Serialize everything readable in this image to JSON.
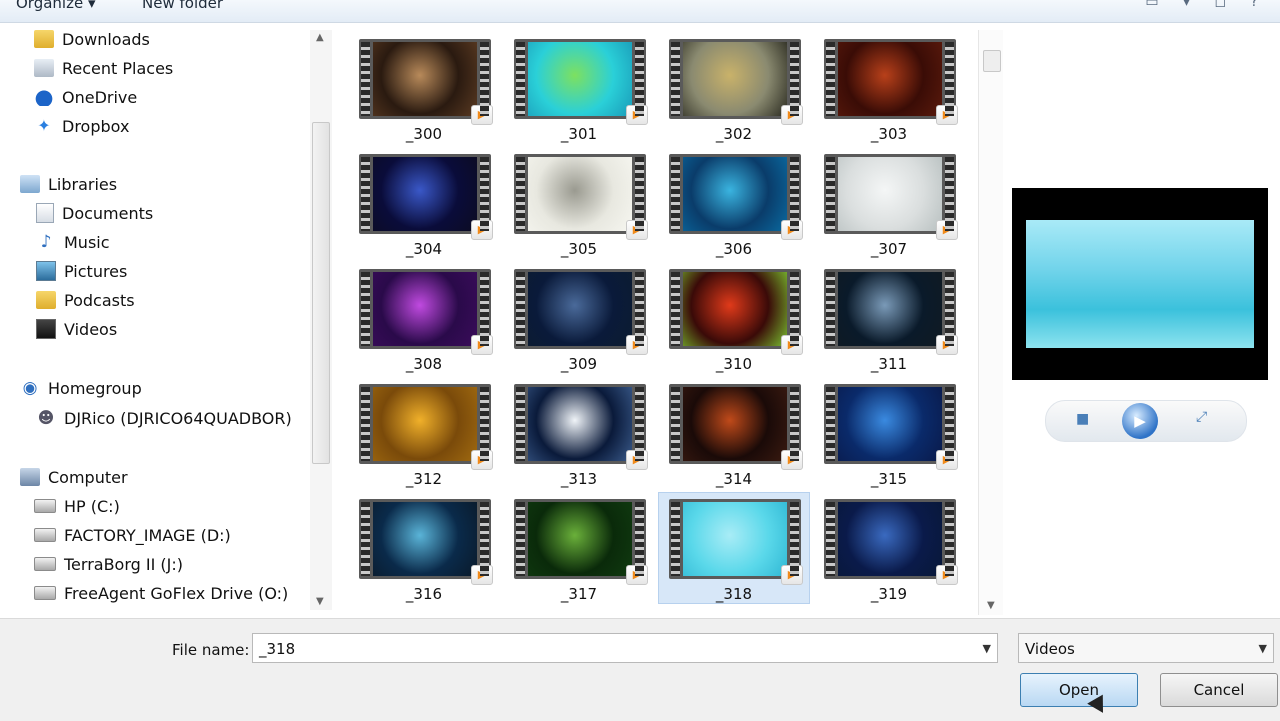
{
  "toolbar": {
    "organize": "Organize",
    "new_folder": "New folder",
    "view_icons": "▭ ▾ ◻ ?"
  },
  "nav": {
    "downloads": "Downloads",
    "recent_places": "Recent Places",
    "onedrive": "OneDrive",
    "dropbox": "Dropbox",
    "libraries": "Libraries",
    "documents": "Documents",
    "music": "Music",
    "pictures": "Pictures",
    "podcasts": "Podcasts",
    "videos": "Videos",
    "homegroup": "Homegroup",
    "user": "DJRico (DJRICO64QUADBOR)",
    "computer": "Computer",
    "hp": "HP (C:)",
    "factory": "FACTORY_IMAGE (D:)",
    "terraborg": "TerraBorg II (J:)",
    "freeagent": "FreeAgent GoFlex Drive (O:)"
  },
  "files": [
    {
      "name": "_300",
      "colors": [
        "#2a1a10",
        "#b88a5a",
        "#5a3a22"
      ]
    },
    {
      "name": "_301",
      "colors": [
        "#2ad0d8",
        "#7de060",
        "#1a9ab8"
      ]
    },
    {
      "name": "_302",
      "colors": [
        "#8a8a70",
        "#c9b26a",
        "#2a2a20"
      ]
    },
    {
      "name": "_303",
      "colors": [
        "#3a0c06",
        "#b8401a",
        "#5a1a0c"
      ]
    },
    {
      "name": "_304",
      "colors": [
        "#0a0c3a",
        "#3a58c8",
        "#0c0c22"
      ]
    },
    {
      "name": "_305",
      "colors": [
        "#e8e8e0",
        "#9a9a90",
        "#f6f6f0"
      ]
    },
    {
      "name": "_306",
      "colors": [
        "#0a3c6a",
        "#3ab4e0",
        "#0a6aa0"
      ]
    },
    {
      "name": "_307",
      "colors": [
        "#dadede",
        "#f4f6f6",
        "#b8c0c0"
      ]
    },
    {
      "name": "_308",
      "colors": [
        "#2a0a4a",
        "#c04ae0",
        "#3a0c5a"
      ]
    },
    {
      "name": "_309",
      "colors": [
        "#0a1a3a",
        "#4a6a9a",
        "#0c1c30"
      ]
    },
    {
      "name": "_310",
      "colors": [
        "#3a0a08",
        "#e03a1a",
        "#7ac030"
      ]
    },
    {
      "name": "_311",
      "colors": [
        "#0a1a2a",
        "#7a9ab8",
        "#101a22"
      ]
    },
    {
      "name": "_312",
      "colors": [
        "#7a4a0a",
        "#f0b02a",
        "#a06a10"
      ]
    },
    {
      "name": "_313",
      "colors": [
        "#0a1a3a",
        "#f0f4f8",
        "#3a5a8a"
      ]
    },
    {
      "name": "_314",
      "colors": [
        "#1a0a08",
        "#c04a1a",
        "#3a1a10"
      ]
    },
    {
      "name": "_315",
      "colors": [
        "#0a2a6a",
        "#3a8ae0",
        "#0a1a4a"
      ]
    },
    {
      "name": "_316",
      "colors": [
        "#0a2a4a",
        "#5ab4d8",
        "#0a1a2a"
      ]
    },
    {
      "name": "_317",
      "colors": [
        "#0a2a0a",
        "#6ab03a",
        "#103a10"
      ]
    },
    {
      "name": "_318",
      "colors": [
        "#5ad8ea",
        "#a8ecf6",
        "#30b8d4"
      ]
    },
    {
      "name": "_319",
      "colors": [
        "#0a1a4a",
        "#3a6ac0",
        "#081838"
      ]
    }
  ],
  "selected_file": "_318",
  "bottom": {
    "file_name_label": "File name:",
    "file_name_value": "_318",
    "filter": "Videos",
    "open": "Open",
    "cancel": "Cancel"
  }
}
